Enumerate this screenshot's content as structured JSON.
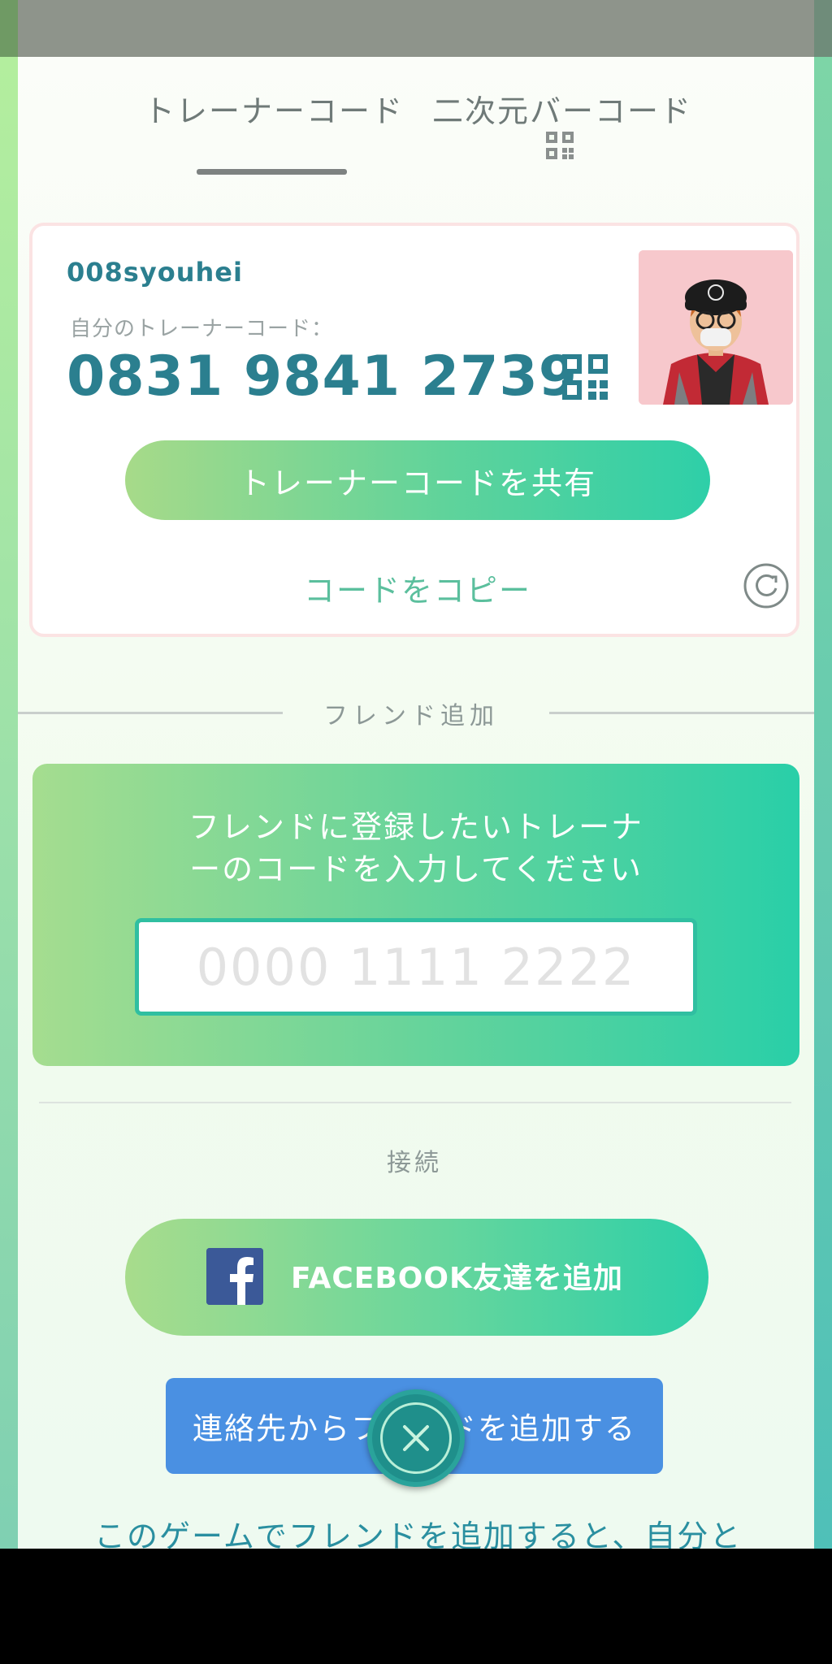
{
  "tabs": [
    {
      "label": "トレーナーコード",
      "active": true
    },
    {
      "label": "二次元バーコード",
      "active": false,
      "icon": "qr-code-icon"
    }
  ],
  "trainer_card": {
    "username": "008syouhei",
    "code_label": "自分のトレーナーコード：",
    "code": "0831 9841 2739",
    "share_button": "トレーナーコードを共有",
    "copy_link": "コードをコピー"
  },
  "add_friend": {
    "section_label": "フレンド追加",
    "instruction_line1": "フレンドに登録したいトレーナ",
    "instruction_line2": "ーのコードを入力してください",
    "input_placeholder": "0000 1111 2222",
    "input_value": ""
  },
  "connect": {
    "section_label": "接続",
    "facebook_button": "FACEBOOK友達を追加",
    "contacts_button": "連絡先からフレンドを追加する"
  },
  "footer_text": "このゲームでフレンドを追加すると、自分と",
  "colors": {
    "accent_teal": "#2b7f8f",
    "button_gradient_start": "#a7da89",
    "button_gradient_end": "#2ecfa8",
    "contacts_blue": "#4a90e2",
    "facebook_blue": "#3b5998"
  }
}
